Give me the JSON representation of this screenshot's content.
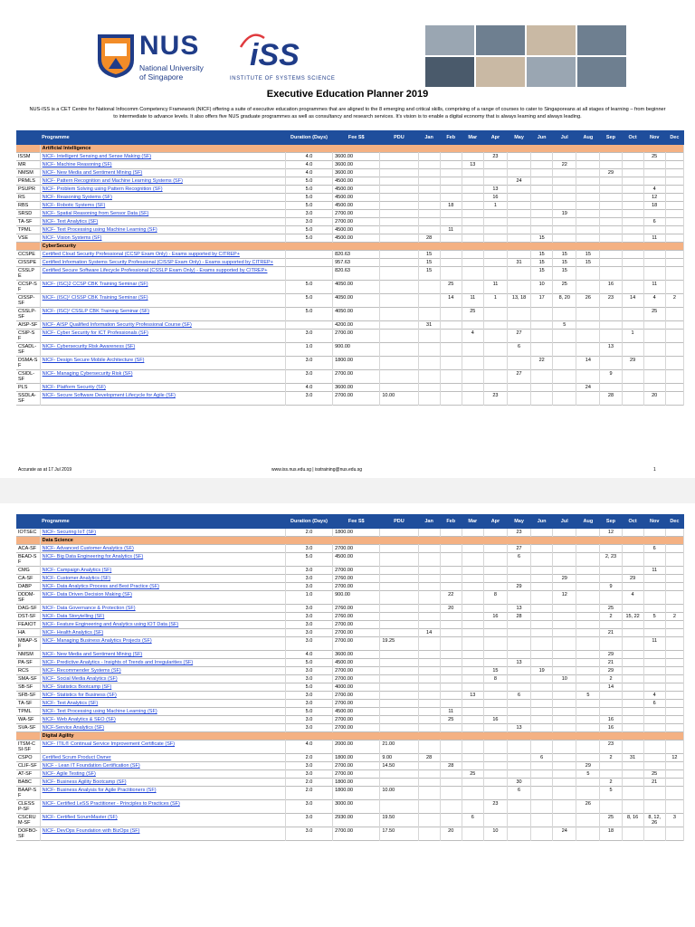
{
  "header": {
    "nus_name": "NUS",
    "nus_sub1": "National University",
    "nus_sub2": "of Singapore",
    "iss_name": "iSS",
    "iss_sub": "INSTITUTE OF SYSTEMS SCIENCE",
    "title": "Executive Education Planner 2019",
    "intro": "NUS-ISS is a CET Centre for National Infocomm Competency Framework (NICF) offering a suite of executive education programmes that are aligned to the 8 emerging and critical skills, comprising of a range of courses to cater to Singaporeans at all stages of learning – from beginner to intermediate to advance levels. It also offers five NUS graduate programmes as well as consultancy and research services. It's vision is to enable a digital economy that is always learning and always leading."
  },
  "columns": [
    "Programme",
    "Duration (Days)",
    "Fee S$",
    "PDU",
    "Jan",
    "Feb",
    "Mar",
    "Apr",
    "May",
    "Jun",
    "Jul",
    "Aug",
    "Sep",
    "Oct",
    "Nov",
    "Dec"
  ],
  "page1_rows": [
    {
      "cat": "Artificial Intelligence"
    },
    {
      "code": "ISSM",
      "title": "NICF- Intelligent Sensing and Sense Making (SF)",
      "dur": "4.0",
      "fee": "3600.00",
      "pdu": "",
      "m": [
        "",
        "",
        "",
        "23",
        "",
        "",
        "",
        "",
        "",
        "",
        "25",
        ""
      ]
    },
    {
      "code": "MR",
      "title": "NICF- Machine Reasoning (SF)",
      "dur": "4.0",
      "fee": "3600.00",
      "pdu": "",
      "m": [
        "",
        "",
        "13",
        "",
        "",
        "",
        "22",
        "",
        "",
        "",
        "",
        ""
      ]
    },
    {
      "code": "NMSM",
      "title": "NICF- New Media and Sentiment Mining (SF)",
      "dur": "4.0",
      "fee": "3600.00",
      "pdu": "",
      "m": [
        "",
        "",
        "",
        "",
        "",
        "",
        "",
        "",
        "29",
        "",
        "",
        ""
      ]
    },
    {
      "code": "PRMLS",
      "title": "NICF- Pattern Recognition and Machine Learning Systems (SF)",
      "dur": "5.0",
      "fee": "4500.00",
      "pdu": "",
      "m": [
        "",
        "",
        "",
        "",
        "24",
        "",
        "",
        "",
        "",
        "",
        "",
        ""
      ]
    },
    {
      "code": "PSUPR",
      "title": "NICF- Problem Solving using Pattern Recognition (SF)",
      "dur": "5.0",
      "fee": "4500.00",
      "pdu": "",
      "m": [
        "",
        "",
        "",
        "13",
        "",
        "",
        "",
        "",
        "",
        "",
        "4",
        ""
      ]
    },
    {
      "code": "RS",
      "title": "NICF- Reasoning Systems (SF)",
      "dur": "5.0",
      "fee": "4500.00",
      "pdu": "",
      "m": [
        "",
        "",
        "",
        "16",
        "",
        "",
        "",
        "",
        "",
        "",
        "12",
        ""
      ]
    },
    {
      "code": "RBS",
      "title": "NICF- Robotic Systems (SF)",
      "dur": "5.0",
      "fee": "4500.00",
      "pdu": "",
      "m": [
        "",
        "18",
        "",
        "1",
        "",
        "",
        "",
        "",
        "",
        "",
        "18",
        ""
      ]
    },
    {
      "code": "SRSD",
      "title": "NICF- Spatial Reasoning from Sensor Data (SF)",
      "dur": "3.0",
      "fee": "2700.00",
      "pdu": "",
      "m": [
        "",
        "",
        "",
        "",
        "",
        "",
        "19",
        "",
        "",
        "",
        "",
        ""
      ]
    },
    {
      "code": "TA-SF",
      "title": "NICF- Text Analytics (SF)",
      "dur": "3.0",
      "fee": "2700.00",
      "pdu": "",
      "m": [
        "",
        "",
        "",
        "",
        "",
        "",
        "",
        "",
        "",
        "",
        "6",
        ""
      ]
    },
    {
      "code": "TPML",
      "title": "NICF- Text Processing using Machine Learning (SF)",
      "dur": "5.0",
      "fee": "4500.00",
      "pdu": "",
      "m": [
        "",
        "11",
        "",
        "",
        "",
        "",
        "",
        "",
        "",
        "",
        "",
        ""
      ]
    },
    {
      "code": "VSE",
      "title": "NICF- Vision Systems (SF)",
      "dur": "5.0",
      "fee": "4500.00",
      "pdu": "",
      "m": [
        "28",
        "",
        "",
        "",
        "",
        "15",
        "",
        "",
        "",
        "",
        "11",
        ""
      ]
    },
    {
      "cat": "CyberSecurity"
    },
    {
      "code": "CCSPE",
      "title": "Certified Cloud Security Professional (CCSP Exam Only) - Exams supported by CITREP+",
      "dur": "",
      "fee": "820.63",
      "pdu": "",
      "m": [
        "15",
        "",
        "",
        "",
        "",
        "15",
        "15",
        "15",
        "",
        "",
        "",
        ""
      ]
    },
    {
      "code": "CISSPE",
      "title": "Certified Information Systems Security Professional (CISSP Exam Only) - Exams supported by CITREP+",
      "dur": "",
      "fee": "957.63",
      "pdu": "",
      "m": [
        "15",
        "",
        "",
        "",
        "31",
        "15",
        "15",
        "15",
        "",
        "",
        "",
        ""
      ]
    },
    {
      "code": "CSSLPE",
      "title": "Certified Secure Software Lifecycle Professional (CSSLP Exam Only) - Exams supported by CITREP+",
      "dur": "",
      "fee": "820.63",
      "pdu": "",
      "m": [
        "15",
        "",
        "",
        "",
        "",
        "15",
        "15",
        "",
        "",
        "",
        "",
        ""
      ]
    },
    {
      "code": "CCSP-SF",
      "title": "NICF- (ISC)2 CCSP CBK Training Seminar (SF)",
      "dur": "5.0",
      "fee": "4050.00",
      "pdu": "",
      "m": [
        "",
        "25",
        "",
        "11",
        "",
        "10",
        "25",
        "",
        "16",
        "",
        "11",
        ""
      ]
    },
    {
      "code": "CISSP-SF",
      "title": "NICF- (ISC)² CISSP CBK Training Seminar (SF)",
      "dur": "5.0",
      "fee": "4050.00",
      "pdu": "",
      "m": [
        "",
        "14",
        "11",
        "1",
        "13, 18",
        "17",
        "8, 20",
        "26",
        "23",
        "14",
        "4",
        "2"
      ]
    },
    {
      "code": "CSSLP-SF",
      "title": "NICF- (ISC)² CSSLP CBK Training Seminar (SF)",
      "dur": "5.0",
      "fee": "4050.00",
      "pdu": "",
      "m": [
        "",
        "",
        "25",
        "",
        "",
        "",
        "",
        "",
        "",
        "",
        "25",
        ""
      ]
    },
    {
      "code": "AISP-SF",
      "title": "NICF- AISP Qualified Information Security Professional Course (SF)",
      "dur": "",
      "fee": "4200.00",
      "pdu": "",
      "m": [
        "31",
        "",
        "",
        "",
        "",
        "",
        "5",
        "",
        "",
        "",
        "",
        ""
      ]
    },
    {
      "code": "CSIP-SF",
      "title": "NICF- Cyber Security for ICT Professionals (SF)",
      "dur": "3.0",
      "fee": "2700.00",
      "pdu": "",
      "m": [
        "",
        "",
        "4",
        "",
        "27",
        "",
        "",
        "",
        "",
        "1",
        "",
        ""
      ]
    },
    {
      "code": "CSADL-SF",
      "title": "NICF- Cybersecurity Risk Awareness (SF)",
      "dur": "1.0",
      "fee": "900.00",
      "pdu": "",
      "m": [
        "",
        "",
        "",
        "",
        "6",
        "",
        "",
        "",
        "13",
        "",
        "",
        ""
      ]
    },
    {
      "code": "DSMA-SF",
      "title": "NICF- Design Secure Mobile Architecture (SF)",
      "dur": "3.0",
      "fee": "1800.00",
      "pdu": "",
      "m": [
        "",
        "",
        "",
        "",
        "",
        "22",
        "",
        "14",
        "",
        "29",
        "",
        ""
      ]
    },
    {
      "code": "CSIDL-SF",
      "title": "NICF- Managing Cybersecurity Risk (SF)",
      "dur": "3.0",
      "fee": "2700.00",
      "pdu": "",
      "m": [
        "",
        "",
        "",
        "",
        "27",
        "",
        "",
        "",
        "9",
        "",
        "",
        ""
      ]
    },
    {
      "code": "PLS",
      "title": "NICF- Platform Security (SF)",
      "dur": "4.0",
      "fee": "3600.00",
      "pdu": "",
      "m": [
        "",
        "",
        "",
        "",
        "",
        "",
        "",
        "24",
        "",
        "",
        "",
        ""
      ]
    },
    {
      "code": "SSDLA-SF",
      "title": "NICF- Secure Software Development Lifecycle for Agile (SF)",
      "dur": "3.0",
      "fee": "2700.00",
      "pdu": "10.00",
      "m": [
        "",
        "",
        "",
        "23",
        "",
        "",
        "",
        "",
        "28",
        "",
        "20",
        ""
      ]
    }
  ],
  "footer": {
    "left": "Accurate as at 17 Jul 2019",
    "center": "www.iss.nus.edu.sg | isstraining@nus.edu.sg",
    "right": "1"
  },
  "page2_rows": [
    {
      "code": "IOTSEC",
      "title": "NICF- Securing IoT (SF)",
      "dur": "2.0",
      "fee": "1800.00",
      "pdu": "",
      "m": [
        "",
        "",
        "",
        "",
        "23",
        "",
        "",
        "",
        "12",
        "",
        "",
        ""
      ]
    },
    {
      "cat": "Data Science"
    },
    {
      "code": "ACA-SF",
      "title": "NICF- Advanced Customer Analytics (SF)",
      "dur": "3.0",
      "fee": "2700.00",
      "pdu": "",
      "m": [
        "",
        "",
        "",
        "",
        "27",
        "",
        "",
        "",
        "",
        "",
        "6",
        ""
      ]
    },
    {
      "code": "BEAD-SF",
      "title": "NICF- Big Data Engineering for Analytics (SF)",
      "dur": "5.0",
      "fee": "4500.00",
      "pdu": "",
      "m": [
        "",
        "",
        "",
        "",
        "6",
        "",
        "",
        "",
        "2, 23",
        "",
        "",
        ""
      ]
    },
    {
      "code": "CMG",
      "title": "NICF- Campaign Analytics (SF)",
      "dur": "3.0",
      "fee": "2700.00",
      "pdu": "",
      "m": [
        "",
        "",
        "",
        "",
        "",
        "",
        "",
        "",
        "",
        "",
        "11",
        ""
      ]
    },
    {
      "code": "CA-SF",
      "title": "NICF- Customer Analytics (SF)",
      "dur": "3.0",
      "fee": "2760.00",
      "pdu": "",
      "m": [
        "",
        "",
        "",
        "",
        "",
        "",
        "29",
        "",
        "",
        "29",
        "",
        ""
      ]
    },
    {
      "code": "DABP",
      "title": "NICF- Data Analytics Process and Best Practice (SF)",
      "dur": "3.0",
      "fee": "2700.00",
      "pdu": "",
      "m": [
        "",
        "",
        "",
        "",
        "29",
        "",
        "",
        "",
        "9",
        "",
        "",
        ""
      ]
    },
    {
      "code": "DDDM-SF",
      "title": "NICF- Data Driven Decision Making (SF)",
      "dur": "1.0",
      "fee": "900.00",
      "pdu": "",
      "m": [
        "",
        "22",
        "",
        "8",
        "",
        "",
        "12",
        "",
        "",
        "4",
        "",
        ""
      ]
    },
    {
      "code": "DAG-SF",
      "title": "NICF- Data Governance & Protection (SF)",
      "dur": "3.0",
      "fee": "2760.00",
      "pdu": "",
      "m": [
        "",
        "20",
        "",
        "",
        "13",
        "",
        "",
        "",
        "25",
        "",
        "",
        ""
      ]
    },
    {
      "code": "DST-SF",
      "title": "NICF- Data Storytelling (SF)",
      "dur": "3.0",
      "fee": "2760.00",
      "pdu": "",
      "m": [
        "",
        "",
        "",
        "16",
        "28",
        "",
        "",
        "",
        "2",
        "15, 22",
        "5",
        "2"
      ]
    },
    {
      "code": "FEAIOT",
      "title": "NICF- Feature Engineering and Analytics using IOT Data (SF)",
      "dur": "3.0",
      "fee": "2700.00",
      "pdu": "",
      "m": [
        "",
        "",
        "",
        "",
        "",
        "",
        "",
        "",
        "",
        "",
        "",
        ""
      ]
    },
    {
      "code": "HA",
      "title": "NICF- Health Analytics (SF)",
      "dur": "3.0",
      "fee": "2700.00",
      "pdu": "",
      "m": [
        "14",
        "",
        "",
        "",
        "",
        "",
        "",
        "",
        "21",
        "",
        "",
        ""
      ]
    },
    {
      "code": "MBAP-SF",
      "title": "NICF- Managing Business Analytics Projects (SF)",
      "dur": "3.0",
      "fee": "2700.00",
      "pdu": "19.25",
      "m": [
        "",
        "",
        "",
        "",
        "",
        "",
        "",
        "",
        "",
        "",
        "11",
        ""
      ]
    },
    {
      "code": "NMSM",
      "title": "NICF- New Media and Sentiment Mining (SF)",
      "dur": "4.0",
      "fee": "3600.00",
      "pdu": "",
      "m": [
        "",
        "",
        "",
        "",
        "",
        "",
        "",
        "",
        "29",
        "",
        "",
        ""
      ]
    },
    {
      "code": "PA-SF",
      "title": "NICF- Predictive Analytics - Insights of Trends and Irregularities (SF)",
      "dur": "5.0",
      "fee": "4500.00",
      "pdu": "",
      "m": [
        "",
        "",
        "",
        "",
        "13",
        "",
        "",
        "",
        "21",
        "",
        "",
        ""
      ]
    },
    {
      "code": "RCS",
      "title": "NICF- Recommender Systems (SF)",
      "dur": "3.0",
      "fee": "2700.00",
      "pdu": "",
      "m": [
        "",
        "",
        "",
        "15",
        "",
        "19",
        "",
        "",
        "29",
        "",
        "",
        ""
      ]
    },
    {
      "code": "SMA-SF",
      "title": "NICF- Social Media Analytics (SF)",
      "dur": "3.0",
      "fee": "2700.00",
      "pdu": "",
      "m": [
        "",
        "",
        "",
        "8",
        "",
        "",
        "10",
        "",
        "2",
        "",
        "",
        ""
      ]
    },
    {
      "code": "SB-SF",
      "title": "NICF- Statistics Bootcamp (SF)",
      "dur": "5.0",
      "fee": "4000.00",
      "pdu": "",
      "m": [
        "",
        "",
        "",
        "",
        "",
        "",
        "",
        "",
        "14",
        "",
        "",
        ""
      ]
    },
    {
      "code": "SFB-SF",
      "title": "NICF- Statistics for Business (SF)",
      "dur": "3.0",
      "fee": "2700.00",
      "pdu": "",
      "m": [
        "",
        "",
        "13",
        "",
        "6",
        "",
        "",
        "5",
        "",
        "",
        "4",
        ""
      ]
    },
    {
      "code": "TA-SF",
      "title": "NICF- Text Analytics (SF)",
      "dur": "3.0",
      "fee": "2700.00",
      "pdu": "",
      "m": [
        "",
        "",
        "",
        "",
        "",
        "",
        "",
        "",
        "",
        "",
        "6",
        ""
      ]
    },
    {
      "code": "TPML",
      "title": "NICF- Text Processing using Machine Learning (SF)",
      "dur": "5.0",
      "fee": "4500.00",
      "pdu": "",
      "m": [
        "",
        "11",
        "",
        "",
        "",
        "",
        "",
        "",
        "",
        "",
        "",
        ""
      ]
    },
    {
      "code": "WA-SF",
      "title": "NICF- Web Analytics & SEO (SF)",
      "dur": "3.0",
      "fee": "2700.00",
      "pdu": "",
      "m": [
        "",
        "25",
        "",
        "16",
        "",
        "",
        "",
        "",
        "16",
        "",
        "",
        ""
      ]
    },
    {
      "code": "SVA-SF",
      "title": "NICF-Service Analytics (SF)",
      "dur": "3.0",
      "fee": "2700.00",
      "pdu": "",
      "m": [
        "",
        "",
        "",
        "",
        "13",
        "",
        "",
        "",
        "16",
        "",
        "",
        ""
      ]
    },
    {
      "cat": "Digital Agility"
    },
    {
      "code": "ITSM-CSI-SF",
      "title": "NICF- ITIL® Continual Service Improvement Certificate (SF)",
      "dur": "4.0",
      "fee": "2000.00",
      "pdu": "21.00",
      "m": [
        "",
        "",
        "",
        "",
        "",
        "",
        "",
        "",
        "23",
        "",
        "",
        ""
      ]
    },
    {
      "code": "CSPO",
      "title": "Certified Scrum Product Owner",
      "dur": "2.0",
      "fee": "1800.00",
      "pdu": "9.00",
      "m": [
        "28",
        "",
        "",
        "",
        "",
        "6",
        "",
        "",
        "2",
        "31",
        "",
        "12"
      ]
    },
    {
      "code": "CLIF-SF",
      "title": "NICF - Lean IT Foundation Certification (SF)",
      "dur": "3.0",
      "fee": "2700.00",
      "pdu": "14.50",
      "m": [
        "",
        "28",
        "",
        "",
        "",
        "",
        "",
        "29",
        "",
        "",
        "",
        ""
      ]
    },
    {
      "code": "AT-SF",
      "title": "NICF- Agile Testing (SF)",
      "dur": "3.0",
      "fee": "2700.00",
      "pdu": "",
      "m": [
        "",
        "",
        "25",
        "",
        "",
        "",
        "",
        "5",
        "",
        "",
        "25",
        ""
      ]
    },
    {
      "code": "BABC",
      "title": "NICF- Business Agility Bootcamp (SF)",
      "dur": "2.0",
      "fee": "1800.00",
      "pdu": "",
      "m": [
        "",
        "",
        "",
        "",
        "30",
        "",
        "",
        "",
        "2",
        "",
        "21",
        ""
      ]
    },
    {
      "code": "BAAP-SF",
      "title": "NICF- Business Analysis for Agile Practitioners (SF)",
      "dur": "2.0",
      "fee": "1800.00",
      "pdu": "10.00",
      "m": [
        "",
        "",
        "",
        "",
        "6",
        "",
        "",
        "",
        "5",
        "",
        "",
        ""
      ]
    },
    {
      "code": "CLESSP-SF",
      "title": "NICF- Certified LeSS Practitioner - Principles to Practices (SF)",
      "dur": "3.0",
      "fee": "3000.00",
      "pdu": "",
      "m": [
        "",
        "",
        "",
        "23",
        "",
        "",
        "",
        "26",
        "",
        "",
        "",
        ""
      ]
    },
    {
      "code": "CSCRUM-SF",
      "title": "NICF- Certified ScrumMaster (SF)",
      "dur": "3.0",
      "fee": "2930.00",
      "pdu": "19.50",
      "m": [
        "",
        "",
        "6",
        "",
        "",
        "",
        "",
        "",
        "25",
        "8, 16",
        "8, 12, 26",
        "3"
      ]
    },
    {
      "code": "DOFBO-SF",
      "title": "NICF- DevOps Foundation with BizOps (SF)",
      "dur": "3.0",
      "fee": "2700.00",
      "pdu": "17.50",
      "m": [
        "",
        "20",
        "",
        "10",
        "",
        "",
        "24",
        "",
        "18",
        "",
        "",
        ""
      ]
    }
  ]
}
